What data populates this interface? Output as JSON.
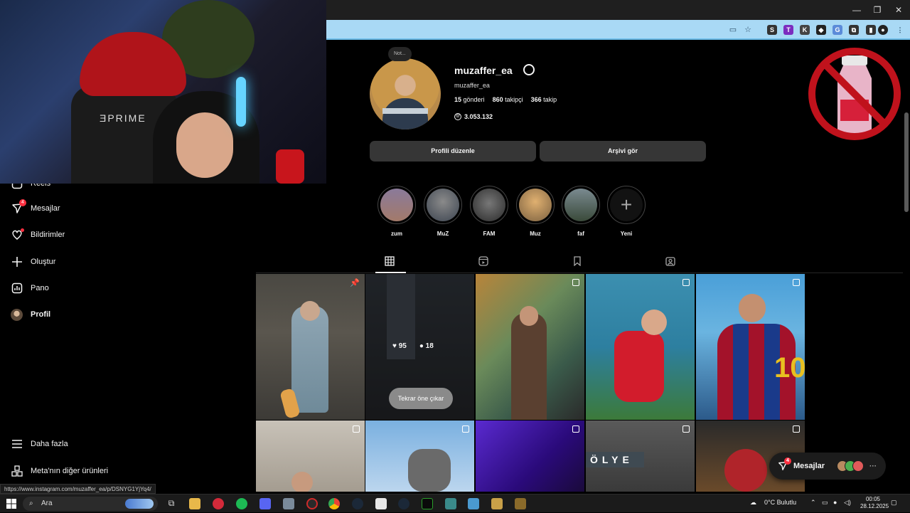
{
  "browser": {
    "controls": [
      "—",
      "❐",
      "✕"
    ],
    "status_url": "https://www.instagram.com/muzaffer_ea/p/DSNYG1YjYq4/"
  },
  "nav": {
    "items": [
      {
        "label": "Reels",
        "icon": "reels-icon"
      },
      {
        "label": "Mesajlar",
        "icon": "messenger-icon",
        "badge": "4"
      },
      {
        "label": "Bildirimler",
        "icon": "heart-icon"
      },
      {
        "label": "Oluştur",
        "icon": "plus-icon"
      },
      {
        "label": "Pano",
        "icon": "dashboard-icon"
      },
      {
        "label": "Profil",
        "icon": "avatar"
      }
    ],
    "more": "Daha fazla",
    "meta": "Meta'nın diğer ürünleri"
  },
  "profile": {
    "note": "Not...",
    "username": "muzaffer_ea",
    "fullname": "muzaffer_ea",
    "posts_count": "15",
    "posts_label": "gönderi",
    "followers_count": "860",
    "followers_label": "takipçi",
    "following_count": "366",
    "following_label": "takip",
    "threads_count": "3.053.132",
    "edit_button": "Profili düzenle",
    "archive_button": "Arşivi gör"
  },
  "highlights": [
    {
      "label": "zum",
      "color": "#8a7a9a"
    },
    {
      "label": "MuZ",
      "color": "#556070"
    },
    {
      "label": "FAM",
      "color": "#4a4a4a"
    },
    {
      "label": "Muz",
      "color": "#c7a067"
    },
    {
      "label": "faf",
      "color": "#5a6a5a"
    },
    {
      "label": "Yeni",
      "color": "#121212"
    }
  ],
  "tabs": [
    "posts-grid-icon",
    "reels-tab-icon",
    "saved-icon",
    "tagged-icon"
  ],
  "grid": {
    "hover_likes": "95",
    "hover_comments": "18",
    "repin_label": "Tekrar öne çıkar"
  },
  "messages_pill": {
    "label": "Mesajlar",
    "badge": "4"
  },
  "taskbar": {
    "search": "Ara",
    "weather": "0°C  Bulutlu",
    "time": "00:05",
    "date": "28.12.2025"
  },
  "colors": {
    "accent": "#0095f6",
    "badge": "#ff3040",
    "button": "#363636"
  }
}
